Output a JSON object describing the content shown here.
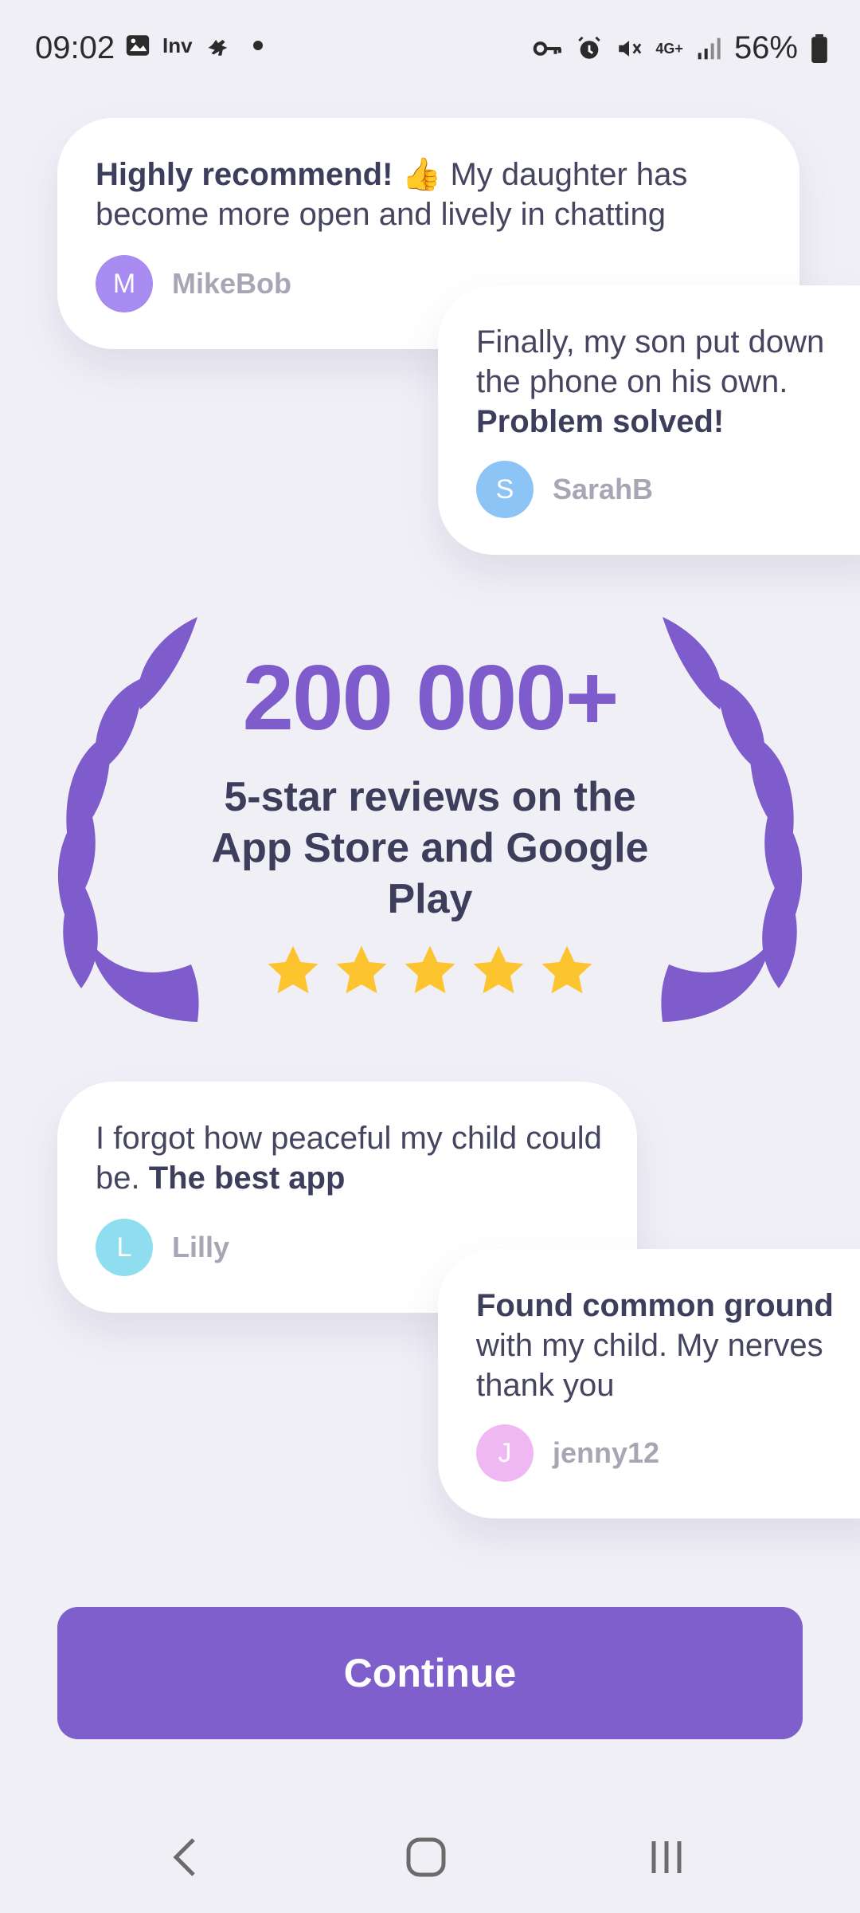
{
  "status_bar": {
    "time": "09:02",
    "carrier_badge": "Inv",
    "network": "4G+",
    "battery": "56%",
    "icons": [
      "image-icon",
      "inv-icon",
      "bird-icon",
      "dot-icon",
      "key-icon",
      "alarm-icon",
      "mute-icon",
      "network-icon",
      "signal-icon",
      "battery-icon"
    ]
  },
  "reviews": [
    {
      "text_bold": "Highly recommend! 👍",
      "text": " My daughter has become more open and lively in chatting",
      "initial": "M",
      "author": "MikeBob",
      "avatar_color": "#a78bf0"
    },
    {
      "text": "Finally, my son put down the phone on his own. ",
      "text_bold": "Problem solved!",
      "initial": "S",
      "author": "SarahB",
      "avatar_color": "#8cc4f5"
    },
    {
      "text": "I forgot how peaceful my child could be. ",
      "text_bold": "The best app",
      "initial": "L",
      "author": "Lilly",
      "avatar_color": "#8fdef0"
    },
    {
      "text_bold": "Found common ground",
      "text": " with my child. My nerves thank you",
      "initial": "J",
      "author": "jenny12",
      "avatar_color": "#f0b8f2"
    }
  ],
  "stats": {
    "count": "200 000+",
    "subtitle": "5-star reviews on the App Store and Google Play",
    "stars": 5,
    "accent_color": "#7f5ccc",
    "star_color": "#fcc530"
  },
  "continue_label": "Continue",
  "nav": [
    "back-icon",
    "home-icon",
    "recents-icon"
  ]
}
